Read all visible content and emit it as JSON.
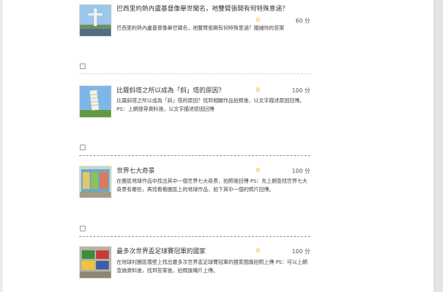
{
  "questions": [
    {
      "title": "巴西里約熱內盧基督像舉世聞名，祂雙臂張開有何特殊意涵？",
      "votes": "0",
      "points": "60 分",
      "desc": "巴西里約熱內盧基督像舉世聞名，祂雙臂張開有何特殊意涵？獵捕你的答案",
      "thumb": "christ-redeemer"
    },
    {
      "title": "比薩斜塔之所以成為「斜」塔的原因？",
      "votes": "0",
      "points": "100 分",
      "desc": "比薩斜塔之所以成為「斜」塔的原因？找到相關作品拍照後，以文字描述原因回傳。 PS：上網搜尋資料後，以文字描述原因回傳",
      "thumb": "pisa-tower"
    },
    {
      "title": "世界七大奇景",
      "votes": "0",
      "points": "100 分",
      "desc": "在園區地球作品中找出其中一個世界七大奇景，拍照後回傳 PS：先上網查找世界七大奇景有哪些，再找看看園區上的地球作品，拍下其中一個的照片回傳。",
      "thumb": "mural-wall"
    },
    {
      "title": "最多次世界盃足球賽冠軍的國家",
      "votes": "0",
      "points": "100 分",
      "desc": "在地球村園區牆壁上找出最多次世界盃足球賽冠軍的國家國旗拍照上傳 PS：可以上網查詢資料後，找到答案後，拍照旗幟片上傳。",
      "thumb": "flag-wall"
    }
  ]
}
